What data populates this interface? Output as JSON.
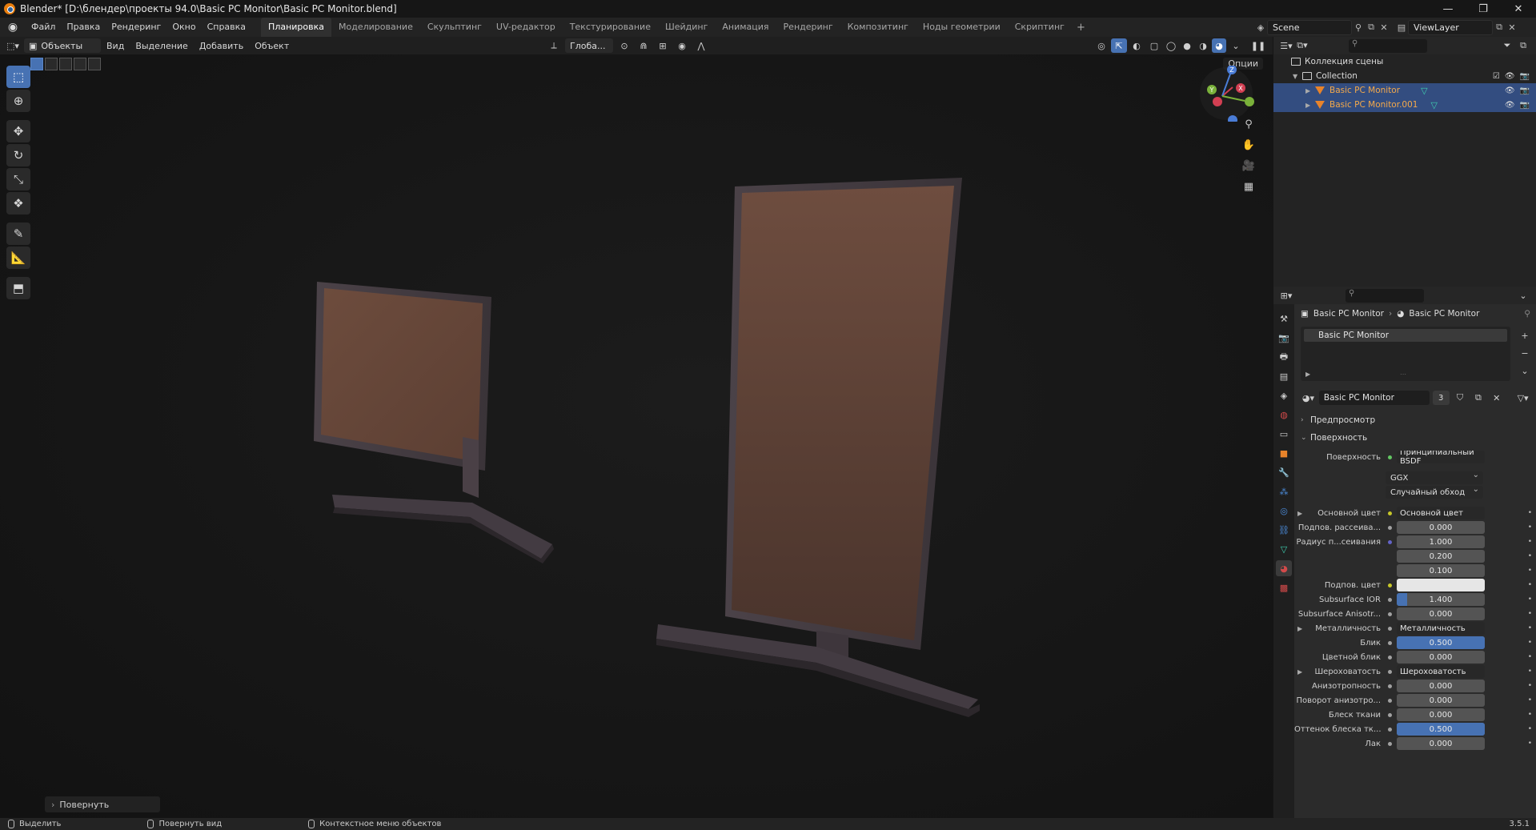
{
  "window": {
    "title": "Blender* [D:\\блендер\\проекты 94.0\\Basic PC Monitor\\Basic PC Monitor.blend]",
    "controls": [
      "—",
      "❐",
      "✕"
    ]
  },
  "menu": [
    "Файл",
    "Правка",
    "Рендеринг",
    "Окно",
    "Справка"
  ],
  "workspaces": [
    "Планировка",
    "Моделирование",
    "Скульптинг",
    "UV-редактор",
    "Текстурирование",
    "Шейдинг",
    "Анимация",
    "Рендеринг",
    "Композитинг",
    "Ноды геометрии",
    "Скриптинг"
  ],
  "active_workspace": "Планировка",
  "workspace_add": "+",
  "scene": {
    "name": "Scene",
    "view_layer": "ViewLayer"
  },
  "viewport_header": {
    "mode": "Объекты",
    "menus": [
      "Вид",
      "Выделение",
      "Добавить",
      "Объект"
    ],
    "transform_orientation": "Глоба...",
    "options": "Опции"
  },
  "last_operator": "Повернуть",
  "outliner": {
    "root": "Коллекция сцены",
    "collection": "Collection",
    "objects": [
      "Basic PC Monitor",
      "Basic PC Monitor.001"
    ]
  },
  "properties": {
    "breadcrumb": [
      "Basic PC Monitor",
      "Basic PC Monitor"
    ],
    "slot": "Basic PC Monitor",
    "material_name": "Basic PC Monitor",
    "user_count": "3",
    "panels": {
      "preview": "Предпросмотр",
      "surface": "Поверхность"
    },
    "surface_label": "Поверхность",
    "surface_shader": "Принципиальный BSDF",
    "distribution": "GGX",
    "subsurface_method": "Случайный обход",
    "rows": [
      {
        "label": "Основной цвет",
        "value": "Основной цвет",
        "kind": "link",
        "expander": true,
        "socket": "yellow"
      },
      {
        "label": "Подпов. рассеива...",
        "value": "0.000",
        "kind": "num",
        "fill": 0,
        "socket": "grey"
      },
      {
        "label": "Радиус п...сеивания",
        "value": "1.000",
        "kind": "num",
        "fill": 0,
        "socket": "violet"
      },
      {
        "label": "",
        "value": "0.200",
        "kind": "num",
        "fill": 0,
        "socket": ""
      },
      {
        "label": "",
        "value": "0.100",
        "kind": "num",
        "fill": 0,
        "socket": ""
      },
      {
        "label": "Подпов. цвет",
        "value": "",
        "kind": "color",
        "socket": "yellow"
      },
      {
        "label": "Subsurface IOR",
        "value": "1.400",
        "kind": "num",
        "fill": 0.12,
        "socket": "grey"
      },
      {
        "label": "Subsurface Anisotr...",
        "value": "0.000",
        "kind": "num",
        "fill": 0,
        "socket": "grey"
      },
      {
        "label": "Металличность",
        "value": "Металличность",
        "kind": "link",
        "expander": true,
        "socket": "grey"
      },
      {
        "label": "Блик",
        "value": "0.500",
        "kind": "num",
        "fill": 1,
        "socket": "grey"
      },
      {
        "label": "Цветной блик",
        "value": "0.000",
        "kind": "num",
        "fill": 0,
        "socket": "grey"
      },
      {
        "label": "Шероховатость",
        "value": "Шероховатость",
        "kind": "link",
        "expander": true,
        "socket": "grey"
      },
      {
        "label": "Анизотропность",
        "value": "0.000",
        "kind": "num",
        "fill": 0,
        "socket": "grey"
      },
      {
        "label": "Поворот анизотро...",
        "value": "0.000",
        "kind": "num",
        "fill": 0,
        "socket": "grey"
      },
      {
        "label": "Блеск ткани",
        "value": "0.000",
        "kind": "num",
        "fill": 0,
        "socket": "grey"
      },
      {
        "label": "Оттенок блеска тк...",
        "value": "0.500",
        "kind": "num",
        "fill": 1,
        "socket": "grey"
      },
      {
        "label": "Лак",
        "value": "0.000",
        "kind": "num",
        "fill": 0,
        "socket": "grey"
      }
    ]
  },
  "statusbar": {
    "select": "Выделить",
    "rotate_view": "Повернуть вид",
    "context_menu": "Контекстное меню объектов",
    "version": "3.5.1"
  },
  "gizmo_axes": [
    "X",
    "Y",
    "Z"
  ],
  "colors": {
    "accent": "#4772b3",
    "selected_row": "#334d80",
    "object_orange": "#f4a94a",
    "screen_material": "#6a4b3d"
  }
}
